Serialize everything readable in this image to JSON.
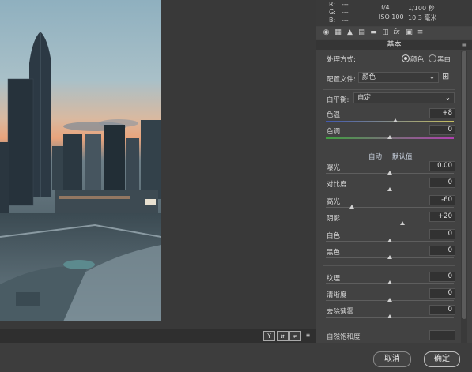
{
  "info": {
    "r_label": "R:",
    "r_value": "---",
    "g_label": "G:",
    "g_value": "---",
    "b_label": "B:",
    "b_value": "---",
    "aperture": "f/4",
    "shutter": "1/100 秒",
    "iso": "ISO 100",
    "focal": "10.3 毫米"
  },
  "tabs": [
    "basic-icon",
    "tone-curve-icon",
    "detail-icon",
    "hsl-icon",
    "split-toning-icon",
    "lens-icon",
    "fx-icon",
    "camera-calibration-icon",
    "presets-icon"
  ],
  "panel_title": "基本",
  "treatment": {
    "label": "处理方式:",
    "color": "颜色",
    "bw": "黑白"
  },
  "profile": {
    "label": "配置文件:",
    "value": "颜色"
  },
  "white_balance": {
    "label": "白平衡:",
    "value": "自定"
  },
  "sliders": {
    "temperature": {
      "label": "色温",
      "value": "+8"
    },
    "tint": {
      "label": "色调",
      "value": "0"
    },
    "exposure": {
      "label": "曝光",
      "value": "0.00"
    },
    "contrast": {
      "label": "对比度",
      "value": "0"
    },
    "highlights": {
      "label": "高光",
      "value": "-60"
    },
    "shadows": {
      "label": "阴影",
      "value": "+20"
    },
    "whites": {
      "label": "白色",
      "value": "0"
    },
    "blacks": {
      "label": "黑色",
      "value": "0"
    },
    "texture": {
      "label": "纹理",
      "value": "0"
    },
    "clarity": {
      "label": "清晰度",
      "value": "0"
    },
    "dehaze": {
      "label": "去除薄雾",
      "value": "0"
    },
    "vibrance": {
      "label": "自然饱和度",
      "value": ""
    }
  },
  "auto_label": "自动",
  "default_label": "默认值",
  "toolbar": {
    "y": "Y",
    "compare": "⇵",
    "swap": "⇄",
    "settings": "≡"
  },
  "buttons": {
    "cancel": "取消",
    "ok": "确定"
  }
}
